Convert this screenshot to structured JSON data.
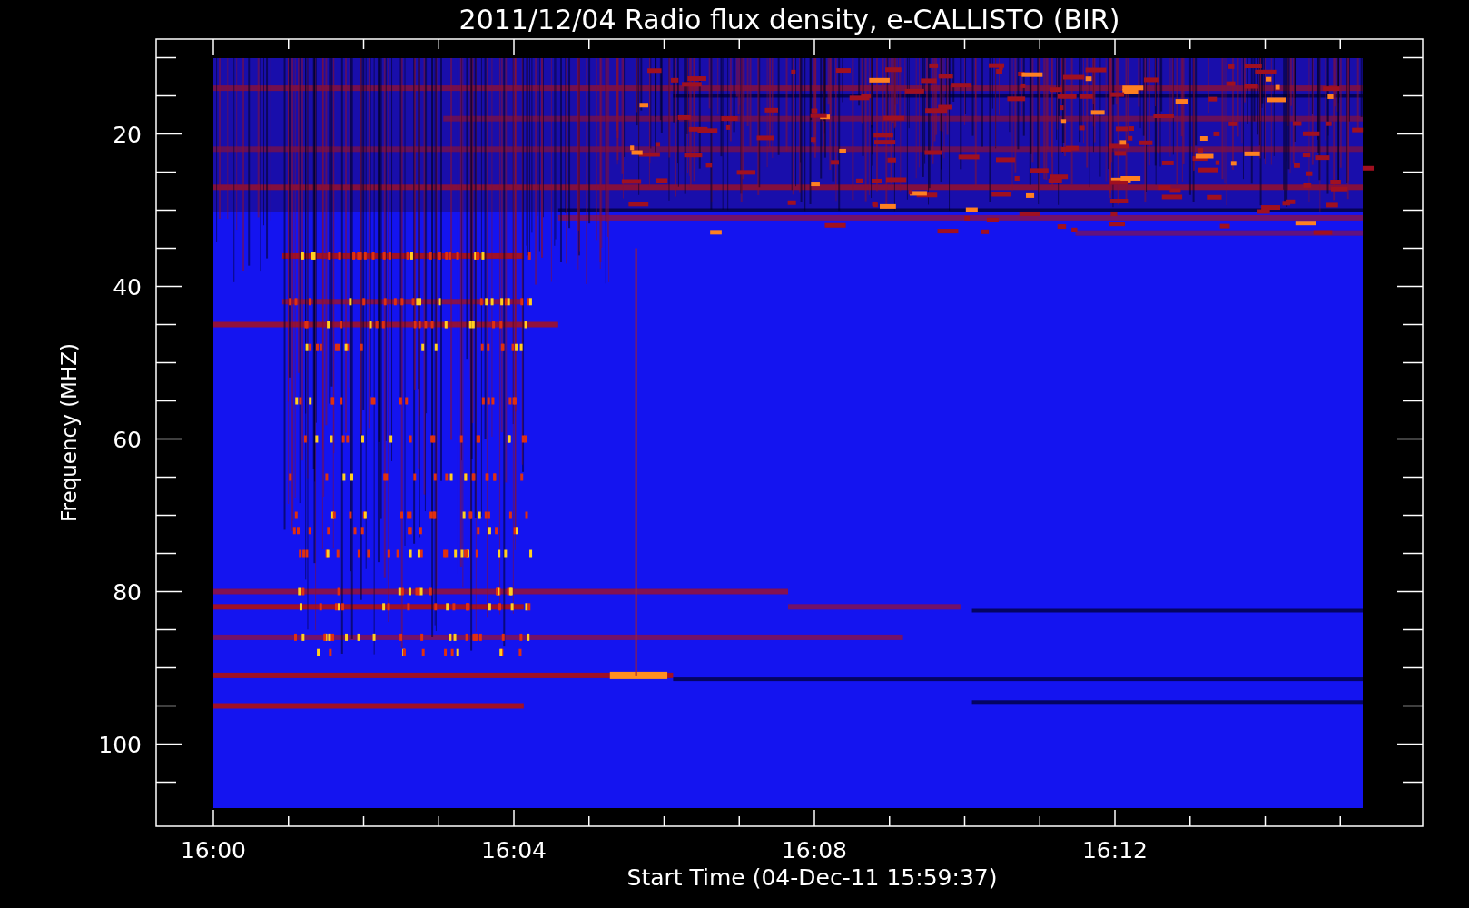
{
  "plot": {
    "title": "2011/12/04  Radio flux density, e-CALLISTO (BIR)",
    "ylabel": "Frequency (MHZ)",
    "xlabel": "Start Time (04-Dec-11 15:59:37)",
    "yticks": [
      "20",
      "40",
      "60",
      "80",
      "100"
    ],
    "xticks": [
      "16:00",
      "16:04",
      "16:08",
      "16:12"
    ]
  }
}
